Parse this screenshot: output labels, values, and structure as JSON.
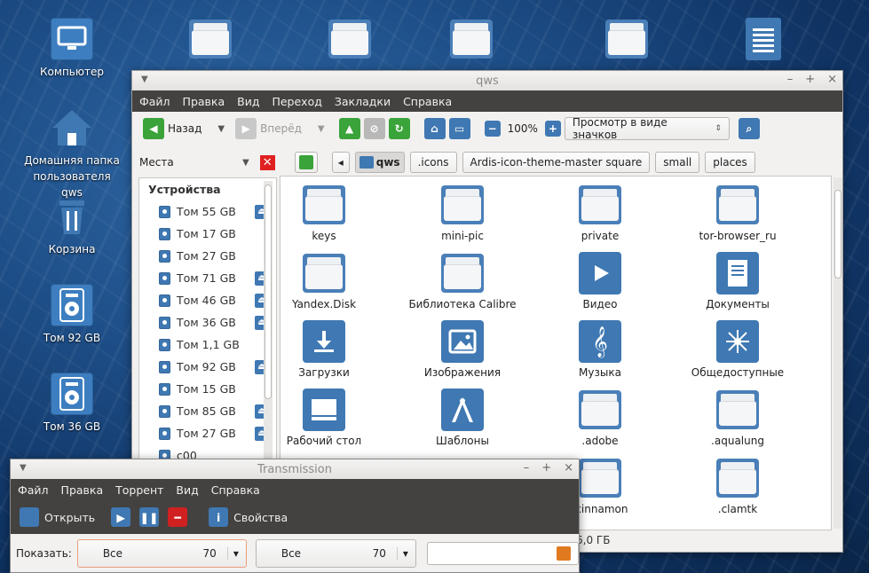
{
  "desktop": {
    "icons": [
      {
        "label": "Компьютер",
        "icon": "monitor-icon"
      },
      {
        "label": "Домашняя папка пользователя qws",
        "icon": "home-icon"
      },
      {
        "label": "Корзина",
        "icon": "trash-icon"
      },
      {
        "label": "Том 92 GB",
        "icon": "drive-icon"
      },
      {
        "label": "Том 36 GB",
        "icon": "drive-icon"
      }
    ]
  },
  "fm": {
    "title": "qws",
    "menu": [
      "Файл",
      "Правка",
      "Вид",
      "Переход",
      "Закладки",
      "Справка"
    ],
    "toolbar": {
      "back": "Назад",
      "forward": "Вперёд",
      "zoom": "100%",
      "view_mode": "Просмотр в виде значков"
    },
    "places_label": "Места",
    "breadcrumbs": [
      "qws",
      ".icons",
      "Ardis-icon-theme-master square",
      "small",
      "places"
    ],
    "sidebar_header": "Устройства",
    "devices": [
      {
        "label": "Том 55 GB",
        "eject": true
      },
      {
        "label": "Том 17 GB",
        "eject": false
      },
      {
        "label": "Том 27 GB",
        "eject": false
      },
      {
        "label": "Том 71 GB",
        "eject": true
      },
      {
        "label": "Том 46 GB",
        "eject": true
      },
      {
        "label": "Том 36 GB",
        "eject": true
      },
      {
        "label": "Том 1,1 GB",
        "eject": false
      },
      {
        "label": "Том 92 GB",
        "eject": true
      },
      {
        "label": "Том 15 GB",
        "eject": false
      },
      {
        "label": "Том 85 GB",
        "eject": true
      },
      {
        "label": "Том 27 GB",
        "eject": true
      },
      {
        "label": "c00",
        "eject": false
      }
    ],
    "items": [
      {
        "name": "keys",
        "icon": "folder-icon"
      },
      {
        "name": "mini-pic",
        "icon": "folder-icon"
      },
      {
        "name": "private",
        "icon": "folder-icon"
      },
      {
        "name": "tor-browser_ru",
        "icon": "folder-icon"
      },
      {
        "name": "Yandex.Disk",
        "icon": "folder-icon"
      },
      {
        "name": "Библиотека Calibre",
        "icon": "folder-icon"
      },
      {
        "name": "Видео",
        "icon": "video-icon"
      },
      {
        "name": "Документы",
        "icon": "documents-icon"
      },
      {
        "name": "Загрузки",
        "icon": "download-icon"
      },
      {
        "name": "Изображения",
        "icon": "pictures-icon"
      },
      {
        "name": "Музыка",
        "icon": "music-icon"
      },
      {
        "name": "Общедоступные",
        "icon": "public-icon"
      },
      {
        "name": "Рабочий стол",
        "icon": "desktop-icon"
      },
      {
        "name": "Шаблоны",
        "icon": "templates-icon"
      },
      {
        "name": ".adobe",
        "icon": "folder-icon"
      },
      {
        "name": ".aqualung",
        "icon": "folder-icon"
      },
      {
        "name": "",
        "icon": "folder-icon"
      },
      {
        "name": "",
        "icon": "folder-icon"
      },
      {
        "name": ".cinnamon",
        "icon": "folder-icon"
      },
      {
        "name": ".clamtk",
        "icon": "folder-icon"
      }
    ],
    "status": "6,0 ГБ"
  },
  "tr": {
    "title": "Transmission",
    "menu": [
      "Файл",
      "Правка",
      "Торрент",
      "Вид",
      "Справка"
    ],
    "open": "Открыть",
    "props": "Свойства",
    "show_label": "Показать:",
    "filter1": {
      "value": "Все",
      "count": "70"
    },
    "filter2": {
      "value": "Все",
      "count": "70"
    }
  }
}
